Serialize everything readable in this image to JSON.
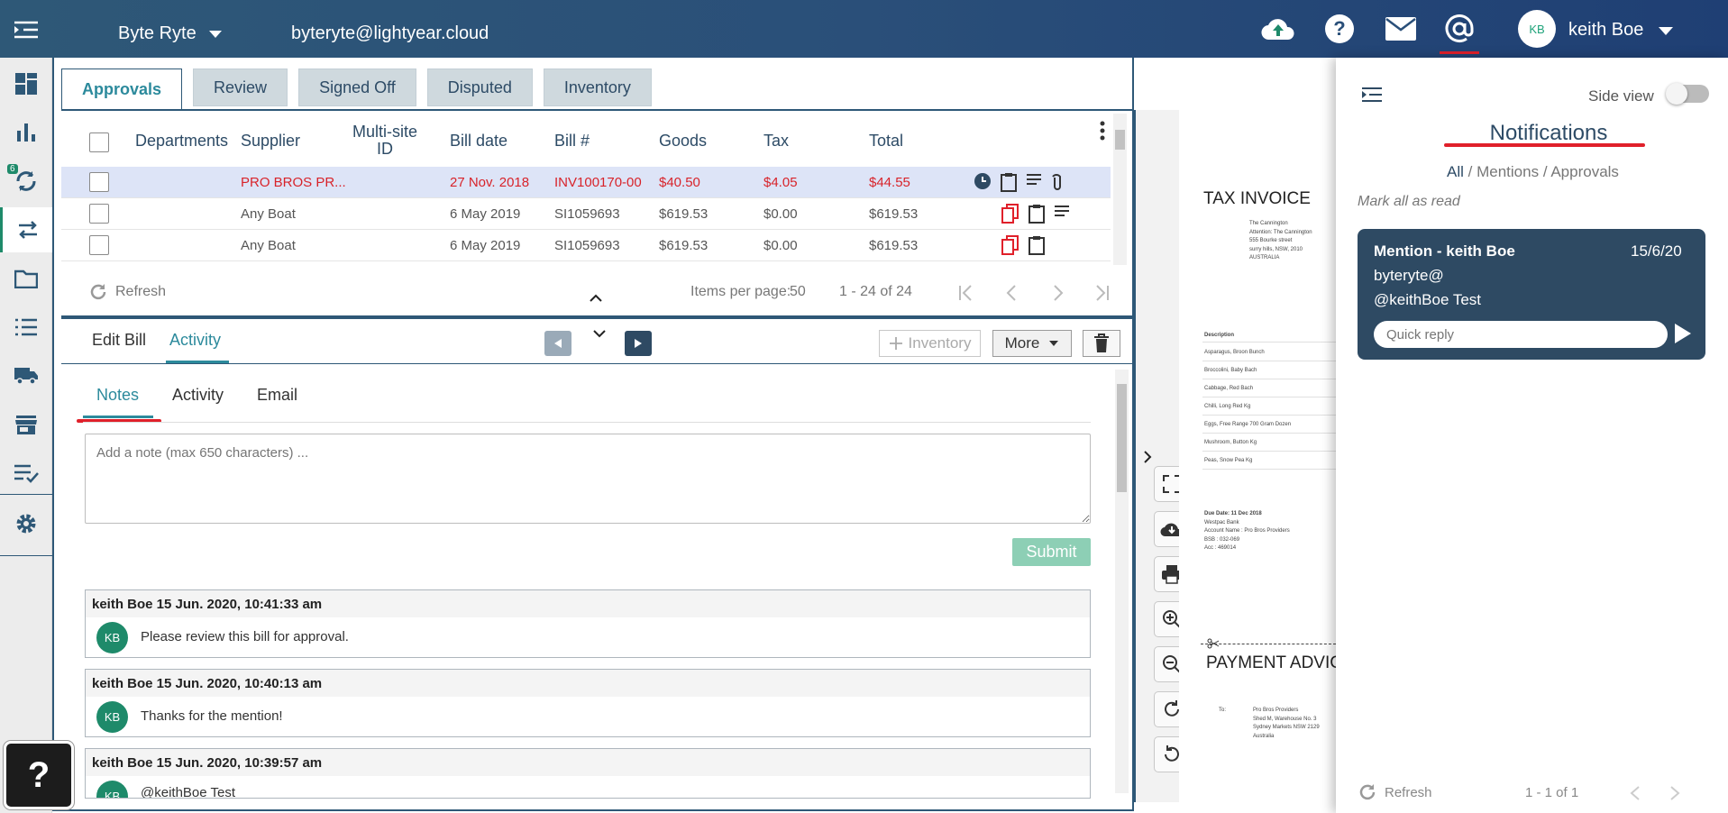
{
  "topbar": {
    "org_name": "Byte Ryte",
    "email": "byteryte@lightyear.cloud",
    "user_initials": "KB",
    "user_name": "keith Boe"
  },
  "rail": {
    "sync_badge": "6"
  },
  "tabs": [
    {
      "label": "Approvals"
    },
    {
      "label": "Review"
    },
    {
      "label": "Signed Off"
    },
    {
      "label": "Disputed"
    },
    {
      "label": "Inventory"
    }
  ],
  "table": {
    "headers": {
      "departments": "Departments",
      "supplier": "Supplier",
      "multisite": "Multi-site ID",
      "bill_date": "Bill date",
      "bill_no": "Bill #",
      "goods": "Goods",
      "tax": "Tax",
      "total": "Total"
    },
    "rows": [
      {
        "supplier": "PRO BROS PR...",
        "bill_date": "27 Nov. 2018",
        "bill_no": "INV100170-00",
        "goods": "$40.50",
        "tax": "$4.05",
        "total": "$44.55"
      },
      {
        "supplier": "Any Boat",
        "bill_date": "6 May 2019",
        "bill_no": "SI1059693",
        "goods": "$619.53",
        "tax": "$0.00",
        "total": "$619.53"
      },
      {
        "supplier": "Any Boat",
        "bill_date": "6 May 2019",
        "bill_no": "SI1059693",
        "goods": "$619.53",
        "tax": "$0.00",
        "total": "$619.53"
      }
    ]
  },
  "paginator": {
    "refresh": "Refresh",
    "items_per_page_label": "Items per page:",
    "items_per_page": "50",
    "range": "1 - 24 of 24"
  },
  "subhead": {
    "edit_bill": "Edit Bill",
    "activity": "Activity",
    "inventory_btn": "Inventory",
    "more_btn": "More"
  },
  "notes": {
    "tabs": [
      "Notes",
      "Activity",
      "Email"
    ],
    "placeholder": "Add a note (max 650 characters) ...",
    "submit": "Submit",
    "items": [
      {
        "header": "keith Boe 15 Jun. 2020, 10:41:33 am",
        "initials": "KB",
        "message": "Please review this bill for approval."
      },
      {
        "header": "keith Boe 15 Jun. 2020, 10:40:13 am",
        "initials": "KB",
        "message": "Thanks for the mention!"
      },
      {
        "header": "keith Boe 15 Jun. 2020, 10:39:57 am",
        "initials": "KB",
        "message": "@keithBoe Test"
      }
    ]
  },
  "document": {
    "heading": "TAX INVOICE",
    "address_lines": [
      "The Cannington",
      "Attention: The Cannington",
      "555 Bourke street",
      "surry hills, NSW, 2010",
      "AUSTRALIA"
    ],
    "desc_header": "Description",
    "items": [
      "Asparagus, Broon Bunch",
      "Broccolini, Baby Bach",
      "Cabbage, Red Bach",
      "Chilli, Long Red Kg",
      "Eggs, Free Range 700 Gram Dozen",
      "Mushroom, Button Kg",
      "Peas, Snow Pea Kg"
    ],
    "due_lines": [
      "Due Date: 11 Dec 2018",
      "Westpac Bank",
      "Account Name : Pro Bros Providers",
      "BSB : 032-069",
      "Acc : 469014"
    ],
    "payment_heading": "PAYMENT ADVICE",
    "to_label": "To:",
    "to_lines": [
      "Pro Bros Providers",
      "Shed M, Warehouse No. 3",
      "Sydney Markets NSW 2129",
      "Australia"
    ]
  },
  "notifications": {
    "side_view": "Side view",
    "title": "Notifications",
    "filters": [
      "All",
      "Mentions",
      "Approvals"
    ],
    "mark_all": "Mark all as read",
    "card": {
      "title": "Mention - keith Boe",
      "date": "15/6/20",
      "line1": "byteryte@",
      "line2": "@keithBoe Test",
      "reply_placeholder": "Quick reply"
    },
    "refresh": "Refresh",
    "range": "1 - 1 of 1"
  },
  "help": "?"
}
